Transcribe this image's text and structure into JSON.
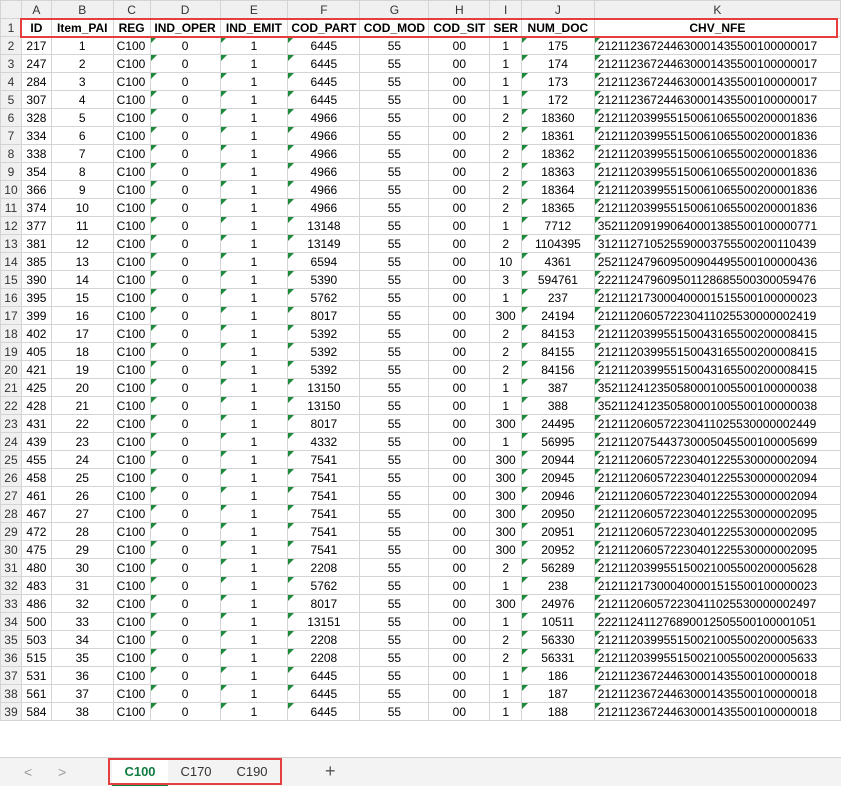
{
  "columns": [
    "A",
    "B",
    "C",
    "D",
    "E",
    "F",
    "G",
    "H",
    "I",
    "J",
    "K"
  ],
  "headers": [
    "ID",
    "Item_PAI",
    "REG",
    "IND_OPER",
    "IND_EMIT",
    "COD_PART",
    "COD_MOD",
    "COD_SIT",
    "SER",
    "NUM_DOC",
    "CHV_NFE"
  ],
  "rows": [
    [
      "217",
      "1",
      "C100",
      "0",
      "1",
      "6445",
      "55",
      "00",
      "1",
      "175",
      "212112367244630001435500100000017"
    ],
    [
      "247",
      "2",
      "C100",
      "0",
      "1",
      "6445",
      "55",
      "00",
      "1",
      "174",
      "212112367244630001435500100000017"
    ],
    [
      "284",
      "3",
      "C100",
      "0",
      "1",
      "6445",
      "55",
      "00",
      "1",
      "173",
      "212112367244630001435500100000017"
    ],
    [
      "307",
      "4",
      "C100",
      "0",
      "1",
      "6445",
      "55",
      "00",
      "1",
      "172",
      "212112367244630001435500100000017"
    ],
    [
      "328",
      "5",
      "C100",
      "0",
      "1",
      "4966",
      "55",
      "00",
      "2",
      "18360",
      "212112039955150061065500200001836"
    ],
    [
      "334",
      "6",
      "C100",
      "0",
      "1",
      "4966",
      "55",
      "00",
      "2",
      "18361",
      "212112039955150061065500200001836"
    ],
    [
      "338",
      "7",
      "C100",
      "0",
      "1",
      "4966",
      "55",
      "00",
      "2",
      "18362",
      "212112039955150061065500200001836"
    ],
    [
      "354",
      "8",
      "C100",
      "0",
      "1",
      "4966",
      "55",
      "00",
      "2",
      "18363",
      "212112039955150061065500200001836"
    ],
    [
      "366",
      "9",
      "C100",
      "0",
      "1",
      "4966",
      "55",
      "00",
      "2",
      "18364",
      "212112039955150061065500200001836"
    ],
    [
      "374",
      "10",
      "C100",
      "0",
      "1",
      "4966",
      "55",
      "00",
      "2",
      "18365",
      "212112039955150061065500200001836"
    ],
    [
      "377",
      "11",
      "C100",
      "0",
      "1",
      "13148",
      "55",
      "00",
      "1",
      "7712",
      "352112091990640001385500100000771"
    ],
    [
      "381",
      "12",
      "C100",
      "0",
      "1",
      "13149",
      "55",
      "00",
      "2",
      "1104395",
      "312112710525590003755500200110439"
    ],
    [
      "385",
      "13",
      "C100",
      "0",
      "1",
      "6594",
      "55",
      "00",
      "10",
      "4361",
      "252112479609500904495500100000436"
    ],
    [
      "390",
      "14",
      "C100",
      "0",
      "1",
      "5390",
      "55",
      "00",
      "3",
      "594761",
      "222112479609501128685500300059476"
    ],
    [
      "395",
      "15",
      "C100",
      "0",
      "1",
      "5762",
      "55",
      "00",
      "1",
      "237",
      "212112173000400001515500100000023"
    ],
    [
      "399",
      "16",
      "C100",
      "0",
      "1",
      "8017",
      "55",
      "00",
      "300",
      "24194",
      "212112060572230411025530000002419"
    ],
    [
      "402",
      "17",
      "C100",
      "0",
      "1",
      "5392",
      "55",
      "00",
      "2",
      "84153",
      "212112039955150043165500200008415"
    ],
    [
      "405",
      "18",
      "C100",
      "0",
      "1",
      "5392",
      "55",
      "00",
      "2",
      "84155",
      "212112039955150043165500200008415"
    ],
    [
      "421",
      "19",
      "C100",
      "0",
      "1",
      "5392",
      "55",
      "00",
      "2",
      "84156",
      "212112039955150043165500200008415"
    ],
    [
      "425",
      "20",
      "C100",
      "0",
      "1",
      "13150",
      "55",
      "00",
      "1",
      "387",
      "352112412350580001005500100000038"
    ],
    [
      "428",
      "21",
      "C100",
      "0",
      "1",
      "13150",
      "55",
      "00",
      "1",
      "388",
      "352112412350580001005500100000038"
    ],
    [
      "431",
      "22",
      "C100",
      "0",
      "1",
      "8017",
      "55",
      "00",
      "300",
      "24495",
      "212112060572230411025530000002449"
    ],
    [
      "439",
      "23",
      "C100",
      "0",
      "1",
      "4332",
      "55",
      "00",
      "1",
      "56995",
      "212112075443730005045500100005699"
    ],
    [
      "455",
      "24",
      "C100",
      "0",
      "1",
      "7541",
      "55",
      "00",
      "300",
      "20944",
      "212112060572230401225530000002094"
    ],
    [
      "458",
      "25",
      "C100",
      "0",
      "1",
      "7541",
      "55",
      "00",
      "300",
      "20945",
      "212112060572230401225530000002094"
    ],
    [
      "461",
      "26",
      "C100",
      "0",
      "1",
      "7541",
      "55",
      "00",
      "300",
      "20946",
      "212112060572230401225530000002094"
    ],
    [
      "467",
      "27",
      "C100",
      "0",
      "1",
      "7541",
      "55",
      "00",
      "300",
      "20950",
      "212112060572230401225530000002095"
    ],
    [
      "472",
      "28",
      "C100",
      "0",
      "1",
      "7541",
      "55",
      "00",
      "300",
      "20951",
      "212112060572230401225530000002095"
    ],
    [
      "475",
      "29",
      "C100",
      "0",
      "1",
      "7541",
      "55",
      "00",
      "300",
      "20952",
      "212112060572230401225530000002095"
    ],
    [
      "480",
      "30",
      "C100",
      "0",
      "1",
      "2208",
      "55",
      "00",
      "2",
      "56289",
      "212112039955150021005500200005628"
    ],
    [
      "483",
      "31",
      "C100",
      "0",
      "1",
      "5762",
      "55",
      "00",
      "1",
      "238",
      "212112173000400001515500100000023"
    ],
    [
      "486",
      "32",
      "C100",
      "0",
      "1",
      "8017",
      "55",
      "00",
      "300",
      "24976",
      "212112060572230411025530000002497"
    ],
    [
      "500",
      "33",
      "C100",
      "0",
      "1",
      "13151",
      "55",
      "00",
      "1",
      "10511",
      "222112411276890012505500100001051"
    ],
    [
      "503",
      "34",
      "C100",
      "0",
      "1",
      "2208",
      "55",
      "00",
      "2",
      "56330",
      "212112039955150021005500200005633"
    ],
    [
      "515",
      "35",
      "C100",
      "0",
      "1",
      "2208",
      "55",
      "00",
      "2",
      "56331",
      "212112039955150021005500200005633"
    ],
    [
      "531",
      "36",
      "C100",
      "0",
      "1",
      "6445",
      "55",
      "00",
      "1",
      "186",
      "212112367244630001435500100000018"
    ],
    [
      "561",
      "37",
      "C100",
      "0",
      "1",
      "6445",
      "55",
      "00",
      "1",
      "187",
      "212112367244630001435500100000018"
    ],
    [
      "584",
      "38",
      "C100",
      "0",
      "1",
      "6445",
      "55",
      "00",
      "1",
      "188",
      "212112367244630001435500100000018"
    ]
  ],
  "tabs": {
    "nav_prev": "<",
    "nav_next": ">",
    "items": [
      "C100",
      "C170",
      "C190"
    ],
    "active": "C100",
    "add": "+"
  },
  "colors": {
    "highlight": "#e53e3e",
    "active_tab": "#107c41",
    "error_marker": "#1e8a3c"
  }
}
